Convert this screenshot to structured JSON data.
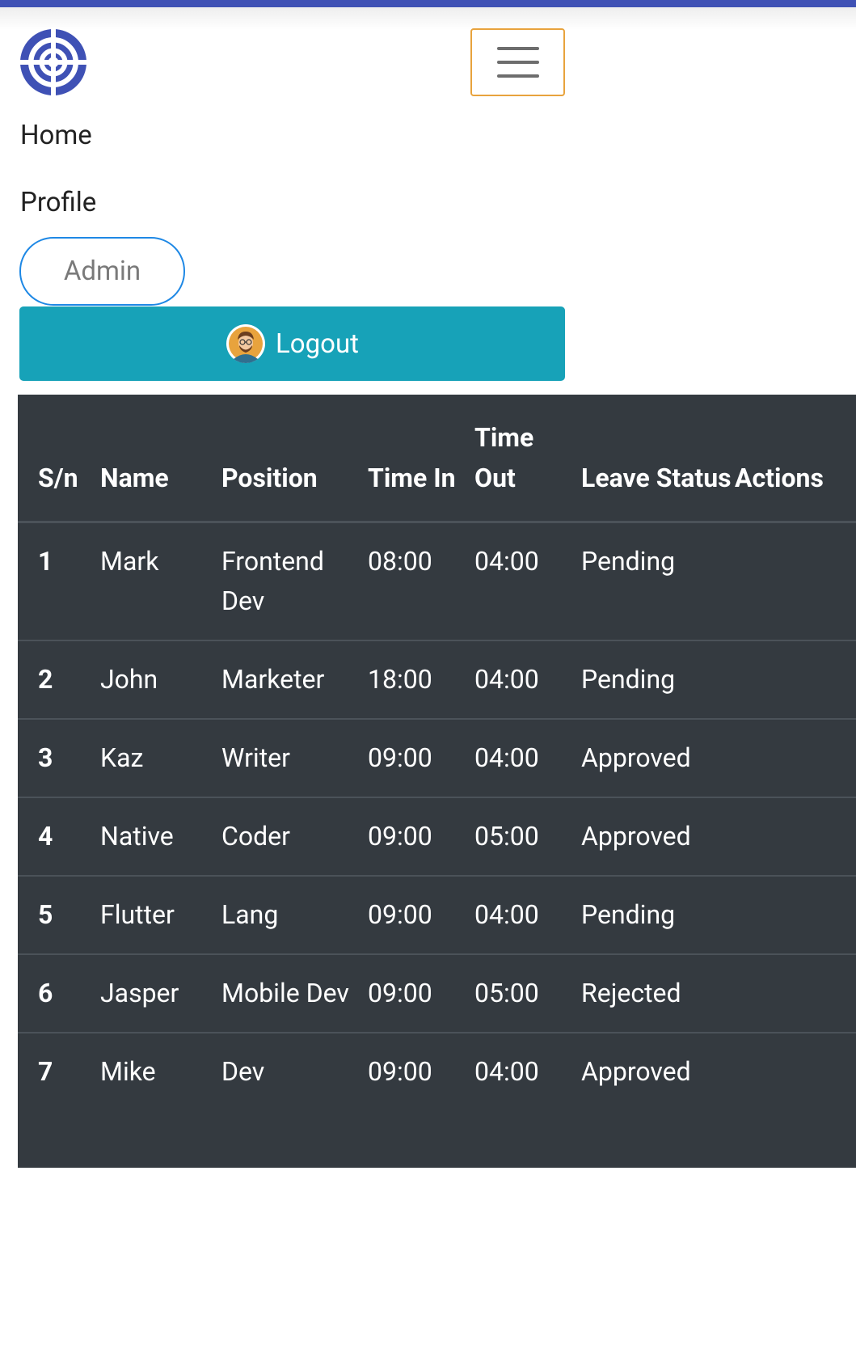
{
  "navbar": {
    "logo_icon": "target-icon",
    "toggler_icon": "hamburger-menu-icon",
    "accent_color": "#3f51b5",
    "toggler_border_color": "#e8a33d"
  },
  "nav": {
    "items": [
      {
        "label": "Home"
      },
      {
        "label": "Profile"
      }
    ],
    "admin_label": "Admin",
    "logout_label": "Logout",
    "logout_color": "#17a2b8"
  },
  "table": {
    "background": "#343a40",
    "headers": {
      "sn": "S/n",
      "name": "Name",
      "position": "Position",
      "time_in": "Time In",
      "time_out": "Time Out",
      "leave_status": "Leave Status",
      "actions": "Actions"
    },
    "rows": [
      {
        "sn": "1",
        "name": "Mark",
        "position": "Frontend Dev",
        "time_in": "08:00",
        "time_out": "04:00",
        "leave_status": "Pending"
      },
      {
        "sn": "2",
        "name": "John",
        "position": "Marketer",
        "time_in": "18:00",
        "time_out": "04:00",
        "leave_status": "Pending"
      },
      {
        "sn": "3",
        "name": "Kaz",
        "position": "Writer",
        "time_in": "09:00",
        "time_out": "04:00",
        "leave_status": "Approved"
      },
      {
        "sn": "4",
        "name": "Native",
        "position": "Coder",
        "time_in": "09:00",
        "time_out": "05:00",
        "leave_status": "Approved"
      },
      {
        "sn": "5",
        "name": "Flutter",
        "position": "Lang",
        "time_in": "09:00",
        "time_out": "04:00",
        "leave_status": "Pending"
      },
      {
        "sn": "6",
        "name": "Jasper",
        "position": "Mobile Dev",
        "time_in": "09:00",
        "time_out": "05:00",
        "leave_status": "Rejected"
      },
      {
        "sn": "7",
        "name": "Mike",
        "position": "Dev",
        "time_in": "09:00",
        "time_out": "04:00",
        "leave_status": "Approved"
      }
    ]
  }
}
